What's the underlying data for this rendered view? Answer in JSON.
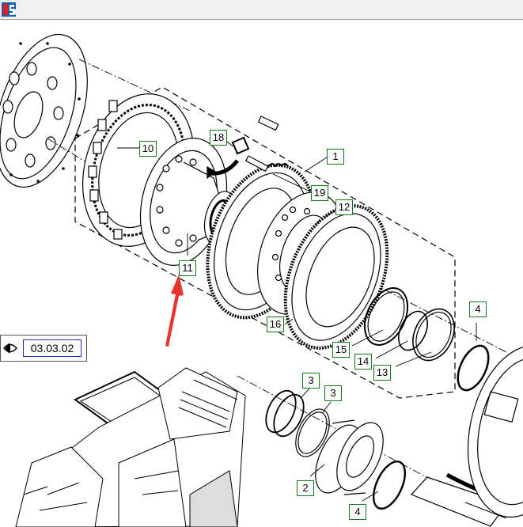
{
  "callouts": {
    "c1": "1",
    "c2": "2",
    "c3a": "3",
    "c3b": "3",
    "c4a": "4",
    "c4b": "4",
    "c10": "10",
    "c11": "11",
    "c12": "12",
    "c13": "13",
    "c14": "14",
    "c15": "15",
    "c16": "16",
    "c18": "18",
    "c19": "19"
  },
  "page_reference": "03.03.02",
  "colors": {
    "callout_border": "#1a7a1a",
    "pointer_arrow": "#e8322a",
    "page_ref_border": "#1b2fb0"
  }
}
